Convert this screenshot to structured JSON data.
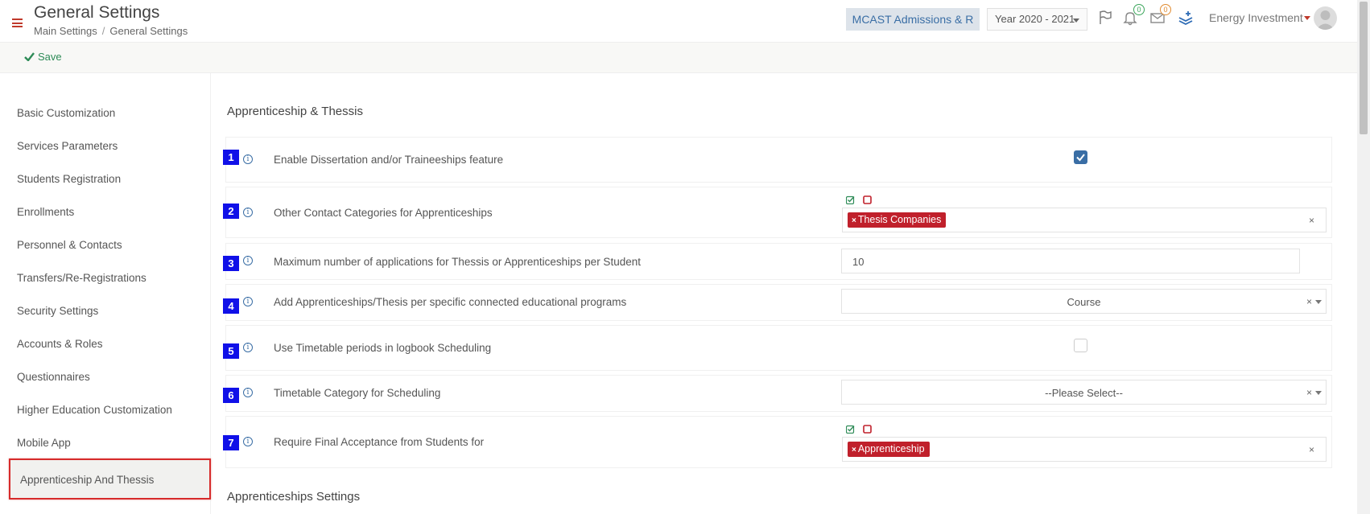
{
  "header": {
    "title": "General Settings",
    "breadcrumb": [
      "Main Settings",
      "General Settings"
    ],
    "institution": "MCAST Admissions & R",
    "year": "Year 2020 - 2021",
    "notifications_count": "0",
    "messages_count": "0",
    "user_name": "Energy Investment"
  },
  "toolbar": {
    "save_label": "Save"
  },
  "sidebar": {
    "items": [
      "Basic Customization",
      "Services Parameters",
      "Students Registration",
      "Enrollments",
      "Personnel & Contacts",
      "Transfers/Re-Registrations",
      "Security Settings",
      "Accounts & Roles",
      "Questionnaires",
      "Higher Education Customization",
      "Mobile App"
    ],
    "active_item": "Apprenticeship And Thessis"
  },
  "main": {
    "section_title": "Apprenticeship & Thessis",
    "next_section_title": "Apprenticeships Settings",
    "rows": [
      {
        "num": "1",
        "label": "Enable Dissertation and/or Traineeships feature",
        "checked": true
      },
      {
        "num": "2",
        "label": "Other Contact Categories for Apprenticeships",
        "tag": "Thesis Companies"
      },
      {
        "num": "3",
        "label": "Maximum number of applications for Thessis or Apprenticeships per Student",
        "value": "10"
      },
      {
        "num": "4",
        "label": "Add Apprenticeships/Thesis per specific connected educational programs",
        "selected": "Course"
      },
      {
        "num": "5",
        "label": "Use Timetable periods in logbook Scheduling",
        "checked": false
      },
      {
        "num": "6",
        "label": "Timetable Category for Scheduling",
        "selected": "--Please Select--"
      },
      {
        "num": "7",
        "label": "Require Final Acceptance from Students for",
        "tag": "Apprenticeship"
      }
    ]
  },
  "colors": {
    "accent_red": "#c0202b",
    "number_badge_blue": "#1010e8",
    "save_green": "#2e8b57",
    "checkbox_blue": "#3a6ea5"
  }
}
